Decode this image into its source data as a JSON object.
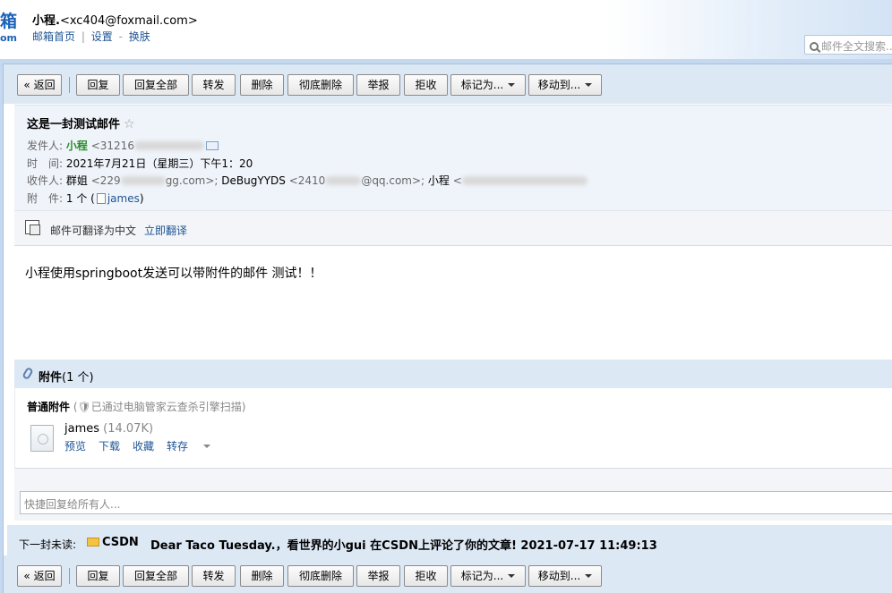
{
  "header": {
    "logo_text": "箱",
    "logo_sub": "om",
    "account_name": "小程.",
    "account_email": "<xc404@foxmail.com>",
    "links": [
      "邮箱首页",
      "设置",
      "换肤"
    ],
    "sep1": "|",
    "sep2": "-",
    "search_placeholder": "邮件全文搜索..."
  },
  "toolbar": {
    "back": "« 返回",
    "reply": "回复",
    "reply_all": "回复全部",
    "forward": "转发",
    "delete": "删除",
    "delete_permanent": "彻底删除",
    "report": "举报",
    "reject": "拒收",
    "mark_as": "标记为...",
    "move_to": "移动到..."
  },
  "mail": {
    "subject": "这是一封测试邮件",
    "star": "☆",
    "sender_label": "发件人:",
    "sender_name": "小程",
    "sender_addr": "<31216",
    "time_label": "时　间:",
    "time_value": "2021年7月21日（星期三）下午1：20",
    "to_label": "收件人:",
    "to_1_name": "群姐",
    "to_1_addr": "<229",
    "to_1_addr_tail": "gg.com>; ",
    "to_2_name": "DeBugYYDS",
    "to_2_addr": "<2410",
    "to_2_addr_tail": "@qq.com>; ",
    "to_3_name": "小程",
    "to_3_addr": "<",
    "att_label": "附　件:",
    "att_count": "1 个 (",
    "att_name": "james",
    "att_close": ")"
  },
  "translate": {
    "text": "邮件可翻译为中文",
    "link": "立即翻译"
  },
  "body": {
    "text": "小程使用springboot发送可以带附件的邮件 测试！！"
  },
  "attachments": {
    "title": "附件",
    "count": "(1 个)",
    "type_label": "普通附件",
    "scan_note": "(🛡已通过电脑管家云查杀引擎扫描)",
    "file_name": "james",
    "file_size": "(14.07K)",
    "actions": [
      "预览",
      "下载",
      "收藏",
      "转存"
    ]
  },
  "quick_reply": {
    "placeholder": "快捷回复给所有人..."
  },
  "next_mail": {
    "label": "下一封未读:",
    "sender": "CSDN",
    "subject": "Dear Taco Tuesday.，看世界的小gui 在CSDN上评论了你的文章! 2021-07-17 11:49:13"
  }
}
